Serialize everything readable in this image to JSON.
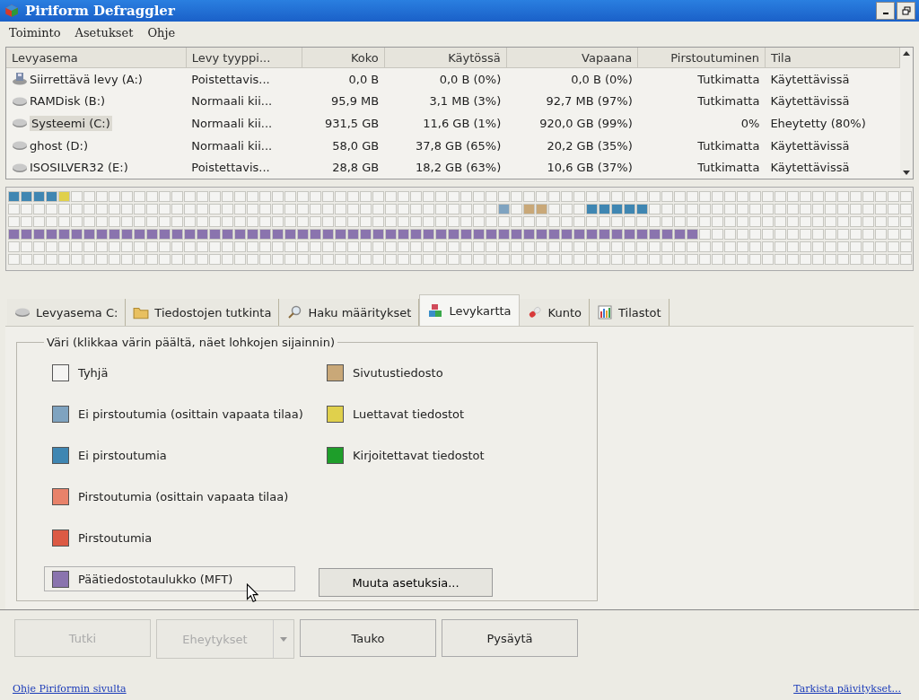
{
  "window": {
    "title": "Piriform Defraggler"
  },
  "menu": [
    "Toiminto",
    "Asetukset",
    "Ohje"
  ],
  "drives": {
    "columns": [
      "Levyasema",
      "Levy tyyppi...",
      "Koko",
      "Käytössä",
      "Vapaana",
      "Pirstoutuminen",
      "Tila"
    ],
    "rows": [
      {
        "kind": "removable",
        "selected": false,
        "cells": [
          "Siirrettävä levy (A:)",
          "Poistettavis...",
          "0,0 B",
          "0,0 B (0%)",
          "0,0 B (0%)",
          "Tutkimatta",
          "Käytettävissä"
        ]
      },
      {
        "kind": "disk",
        "selected": false,
        "cells": [
          "RAMDisk (B:)",
          "Normaali kii...",
          "95,9 MB",
          "3,1 MB (3%)",
          "92,7 MB (97%)",
          "Tutkimatta",
          "Käytettävissä"
        ]
      },
      {
        "kind": "disk",
        "selected": true,
        "cells": [
          "Systeemi (C:)",
          "Normaali kii...",
          "931,5 GB",
          "11,6 GB (1%)",
          "920,0 GB (99%)",
          "0%",
          "Eheytetty (80%)"
        ]
      },
      {
        "kind": "disk",
        "selected": false,
        "cells": [
          "ghost (D:)",
          "Normaali kii...",
          "58,0 GB",
          "37,8 GB (65%)",
          "20,2 GB (35%)",
          "Tutkimatta",
          "Käytettävissä"
        ]
      },
      {
        "kind": "disk",
        "selected": false,
        "cells": [
          "ISOSILVER32 (E:)",
          "Poistettavis...",
          "28,8 GB",
          "18,2 GB (63%)",
          "10,6 GB (37%)",
          "Tutkimatta",
          "Käytettävissä"
        ]
      }
    ]
  },
  "disk_map": {
    "rows": [
      {
        "cells": [
          {
            "kind": "unfragmented"
          },
          {
            "kind": "unfragmented"
          },
          {
            "kind": "unfragmented"
          },
          {
            "kind": "unfragmented"
          },
          {
            "kind": "readable"
          }
        ]
      },
      {
        "cells": [
          {
            "kind": "empty"
          },
          {
            "kind": "empty"
          },
          {
            "kind": "empty"
          },
          {
            "kind": "empty"
          },
          {
            "kind": "empty"
          },
          {
            "kind": "empty"
          },
          {
            "kind": "empty"
          },
          {
            "kind": "empty"
          },
          {
            "kind": "empty"
          },
          {
            "kind": "empty"
          },
          {
            "kind": "empty"
          },
          {
            "kind": "empty"
          },
          {
            "kind": "empty"
          },
          {
            "kind": "empty"
          },
          {
            "kind": "empty"
          },
          {
            "kind": "empty"
          },
          {
            "kind": "empty"
          },
          {
            "kind": "empty"
          },
          {
            "kind": "empty"
          },
          {
            "kind": "empty"
          },
          {
            "kind": "empty"
          },
          {
            "kind": "empty"
          },
          {
            "kind": "empty"
          },
          {
            "kind": "empty"
          },
          {
            "kind": "empty"
          },
          {
            "kind": "empty"
          },
          {
            "kind": "empty"
          },
          {
            "kind": "empty"
          },
          {
            "kind": "empty"
          },
          {
            "kind": "empty"
          },
          {
            "kind": "empty"
          },
          {
            "kind": "empty"
          },
          {
            "kind": "empty"
          },
          {
            "kind": "empty"
          },
          {
            "kind": "empty"
          },
          {
            "kind": "empty"
          },
          {
            "kind": "empty"
          },
          {
            "kind": "empty"
          },
          {
            "kind": "empty"
          },
          {
            "kind": "unfragmented_partial"
          },
          {
            "kind": "empty"
          },
          {
            "kind": "pagefile"
          },
          {
            "kind": "pagefile"
          },
          {
            "kind": "empty"
          },
          {
            "kind": "empty"
          },
          {
            "kind": "empty"
          },
          {
            "kind": "unfragmented"
          },
          {
            "kind": "unfragmented"
          },
          {
            "kind": "unfragmented"
          },
          {
            "kind": "unfragmented"
          },
          {
            "kind": "unfragmented"
          }
        ]
      },
      {
        "cells": [
          {
            "kind": "empty"
          }
        ]
      },
      {
        "cells": [
          {
            "kind": "mft"
          },
          {
            "kind": "mft"
          },
          {
            "kind": "mft"
          },
          {
            "kind": "mft"
          },
          {
            "kind": "mft"
          },
          {
            "kind": "mft"
          },
          {
            "kind": "mft"
          },
          {
            "kind": "mft"
          },
          {
            "kind": "mft"
          },
          {
            "kind": "mft"
          },
          {
            "kind": "mft"
          },
          {
            "kind": "mft"
          },
          {
            "kind": "mft"
          },
          {
            "kind": "mft"
          },
          {
            "kind": "mft"
          },
          {
            "kind": "mft"
          },
          {
            "kind": "mft"
          },
          {
            "kind": "mft"
          },
          {
            "kind": "mft"
          },
          {
            "kind": "mft"
          },
          {
            "kind": "mft"
          },
          {
            "kind": "mft"
          },
          {
            "kind": "mft"
          },
          {
            "kind": "mft"
          },
          {
            "kind": "mft"
          },
          {
            "kind": "mft"
          },
          {
            "kind": "mft"
          },
          {
            "kind": "mft"
          },
          {
            "kind": "mft"
          },
          {
            "kind": "mft"
          },
          {
            "kind": "mft"
          },
          {
            "kind": "mft"
          },
          {
            "kind": "mft"
          },
          {
            "kind": "mft"
          },
          {
            "kind": "mft"
          },
          {
            "kind": "mft"
          },
          {
            "kind": "mft"
          },
          {
            "kind": "mft"
          },
          {
            "kind": "mft"
          },
          {
            "kind": "mft"
          },
          {
            "kind": "mft"
          },
          {
            "kind": "mft"
          },
          {
            "kind": "mft"
          },
          {
            "kind": "mft"
          },
          {
            "kind": "mft"
          },
          {
            "kind": "mft"
          },
          {
            "kind": "mft"
          },
          {
            "kind": "mft"
          },
          {
            "kind": "mft"
          },
          {
            "kind": "mft"
          },
          {
            "kind": "mft"
          },
          {
            "kind": "mft"
          },
          {
            "kind": "mft"
          },
          {
            "kind": "mft"
          },
          {
            "kind": "mft"
          }
        ]
      },
      {
        "cells": [
          {
            "kind": "empty"
          }
        ]
      },
      {
        "cells": [
          {
            "kind": "empty"
          }
        ]
      }
    ]
  },
  "tabs": [
    {
      "label": "Levyasema C:",
      "selected": false
    },
    {
      "label": "Tiedostojen tutkinta",
      "selected": false
    },
    {
      "label": "Haku määritykset",
      "selected": false
    },
    {
      "label": "Levykartta",
      "selected": true
    },
    {
      "label": "Kunto",
      "selected": false
    },
    {
      "label": "Tilastot",
      "selected": false
    }
  ],
  "legend": {
    "title": "Väri (klikkaa värin päältä, näet lohkojen sijainnin)",
    "items": [
      {
        "kind": "empty",
        "label": "Tyhjä",
        "color": "#f4f4f2",
        "focused": false
      },
      {
        "kind": "unfragmented_partial",
        "label": "Ei pirstoutumia (osittain vapaata tilaa)",
        "color": "#7fa3c0",
        "focused": false
      },
      {
        "kind": "unfragmented",
        "label": "Ei pirstoutumia",
        "color": "#3f86b2",
        "focused": false
      },
      {
        "kind": "fragmented_partial",
        "label": "Pirstoutumia (osittain vapaata tilaa)",
        "color": "#e8826a",
        "focused": false
      },
      {
        "kind": "fragmented",
        "label": "Pirstoutumia",
        "color": "#dc5a44",
        "focused": false
      },
      {
        "kind": "mft",
        "label": "Päätiedostotaulukko (MFT)",
        "color": "#8a74ae",
        "focused": true
      },
      {
        "kind": "pagefile",
        "label": "Sivutustiedosto",
        "color": "#c9a878",
        "focused": false
      },
      {
        "kind": "readable",
        "label": "Luettavat tiedostot",
        "color": "#e0d04c",
        "focused": false
      },
      {
        "kind": "writable",
        "label": "Kirjoitettavat tiedostot",
        "color": "#1e9e2a",
        "focused": false
      }
    ],
    "button": "Muuta asetuksia..."
  },
  "actions": [
    {
      "label": "Tutki",
      "disabled": true,
      "split": false
    },
    {
      "label": "Eheytykset",
      "disabled": true,
      "split": true
    },
    {
      "label": "Tauko",
      "disabled": false,
      "split": false
    },
    {
      "label": "Pysäytä",
      "disabled": false,
      "split": false
    }
  ],
  "footer": {
    "left_link": "Ohje Piriformin sivulta",
    "right_link": "Tarkista päivitykset..."
  }
}
